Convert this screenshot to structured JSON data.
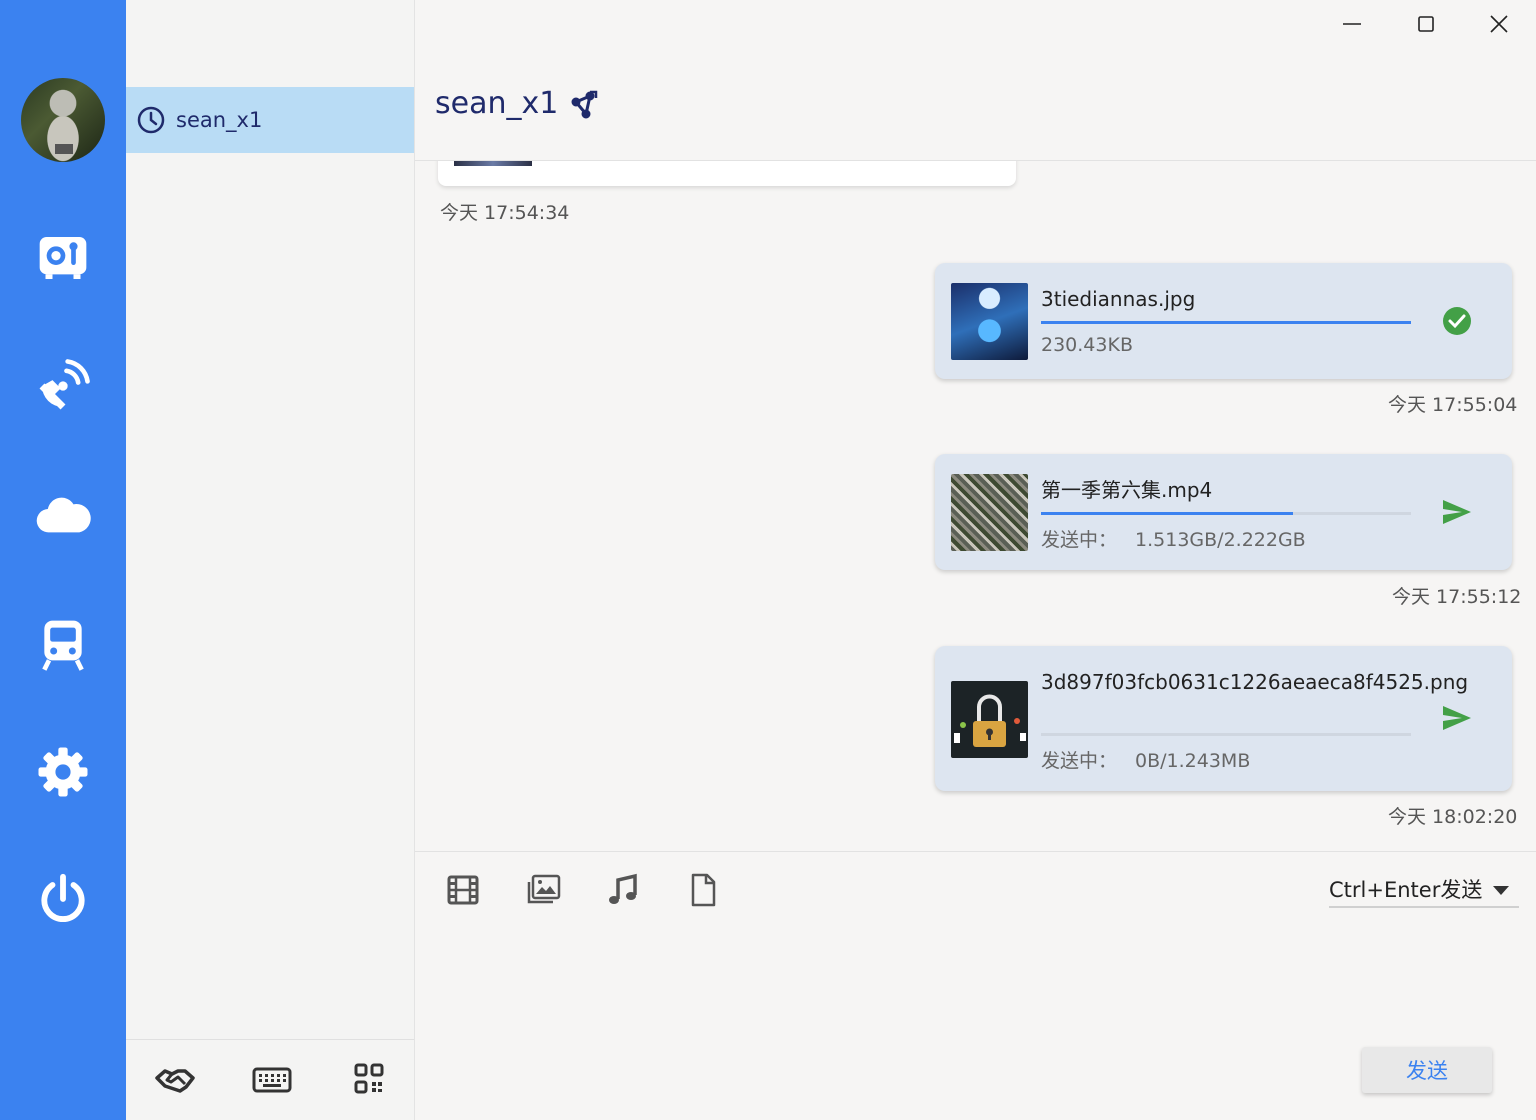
{
  "colors": {
    "accent": "#3b82f0",
    "selected": "#b9dcf5",
    "title": "#1f2a6b",
    "success": "#43a047",
    "send_arrow": "#43a047"
  },
  "rail": {
    "avatar": "avatar-photo",
    "items": [
      {
        "icon": "safe-icon"
      },
      {
        "icon": "satellite-dish-icon"
      },
      {
        "icon": "cloud-icon"
      },
      {
        "icon": "train-icon"
      },
      {
        "icon": "gear-icon"
      },
      {
        "icon": "power-icon"
      }
    ]
  },
  "contacts": {
    "items": [
      {
        "name": "sean_x1",
        "icon": "clock-icon"
      }
    ],
    "footer": [
      {
        "icon": "handshake-icon"
      },
      {
        "icon": "keyboard-icon"
      },
      {
        "icon": "qr-code-icon"
      }
    ]
  },
  "chat": {
    "title": "sean_x1",
    "title_icon": "network-share-icon",
    "messages": [
      {
        "timestamp": "今天 17:54:34"
      },
      {
        "file_name": "3tiediannas.jpg",
        "meta_label": "",
        "meta_value": "230.43KB",
        "progress": 1.0,
        "status": "done",
        "timestamp": "今天 17:55:04"
      },
      {
        "file_name": "第一季第六集.mp4",
        "meta_label": "发送中：",
        "meta_value": "1.513GB/2.222GB",
        "progress": 0.68,
        "status": "sending",
        "timestamp": "今天 17:55:12"
      },
      {
        "file_name": "3d897f03fcb0631c1226aeaeca8f4525.png",
        "meta_label": "发送中：",
        "meta_value": "0B/1.243MB",
        "progress": 0.0,
        "status": "sending",
        "timestamp": "今天 18:02:20"
      }
    ]
  },
  "input": {
    "tools": [
      {
        "icon": "film-icon"
      },
      {
        "icon": "image-icon"
      },
      {
        "icon": "music-icon"
      },
      {
        "icon": "file-icon"
      }
    ],
    "send_mode": "Ctrl+Enter发送",
    "send_label": "发送"
  },
  "window": {
    "controls": [
      "minimize-icon",
      "maximize-icon",
      "close-icon"
    ]
  }
}
